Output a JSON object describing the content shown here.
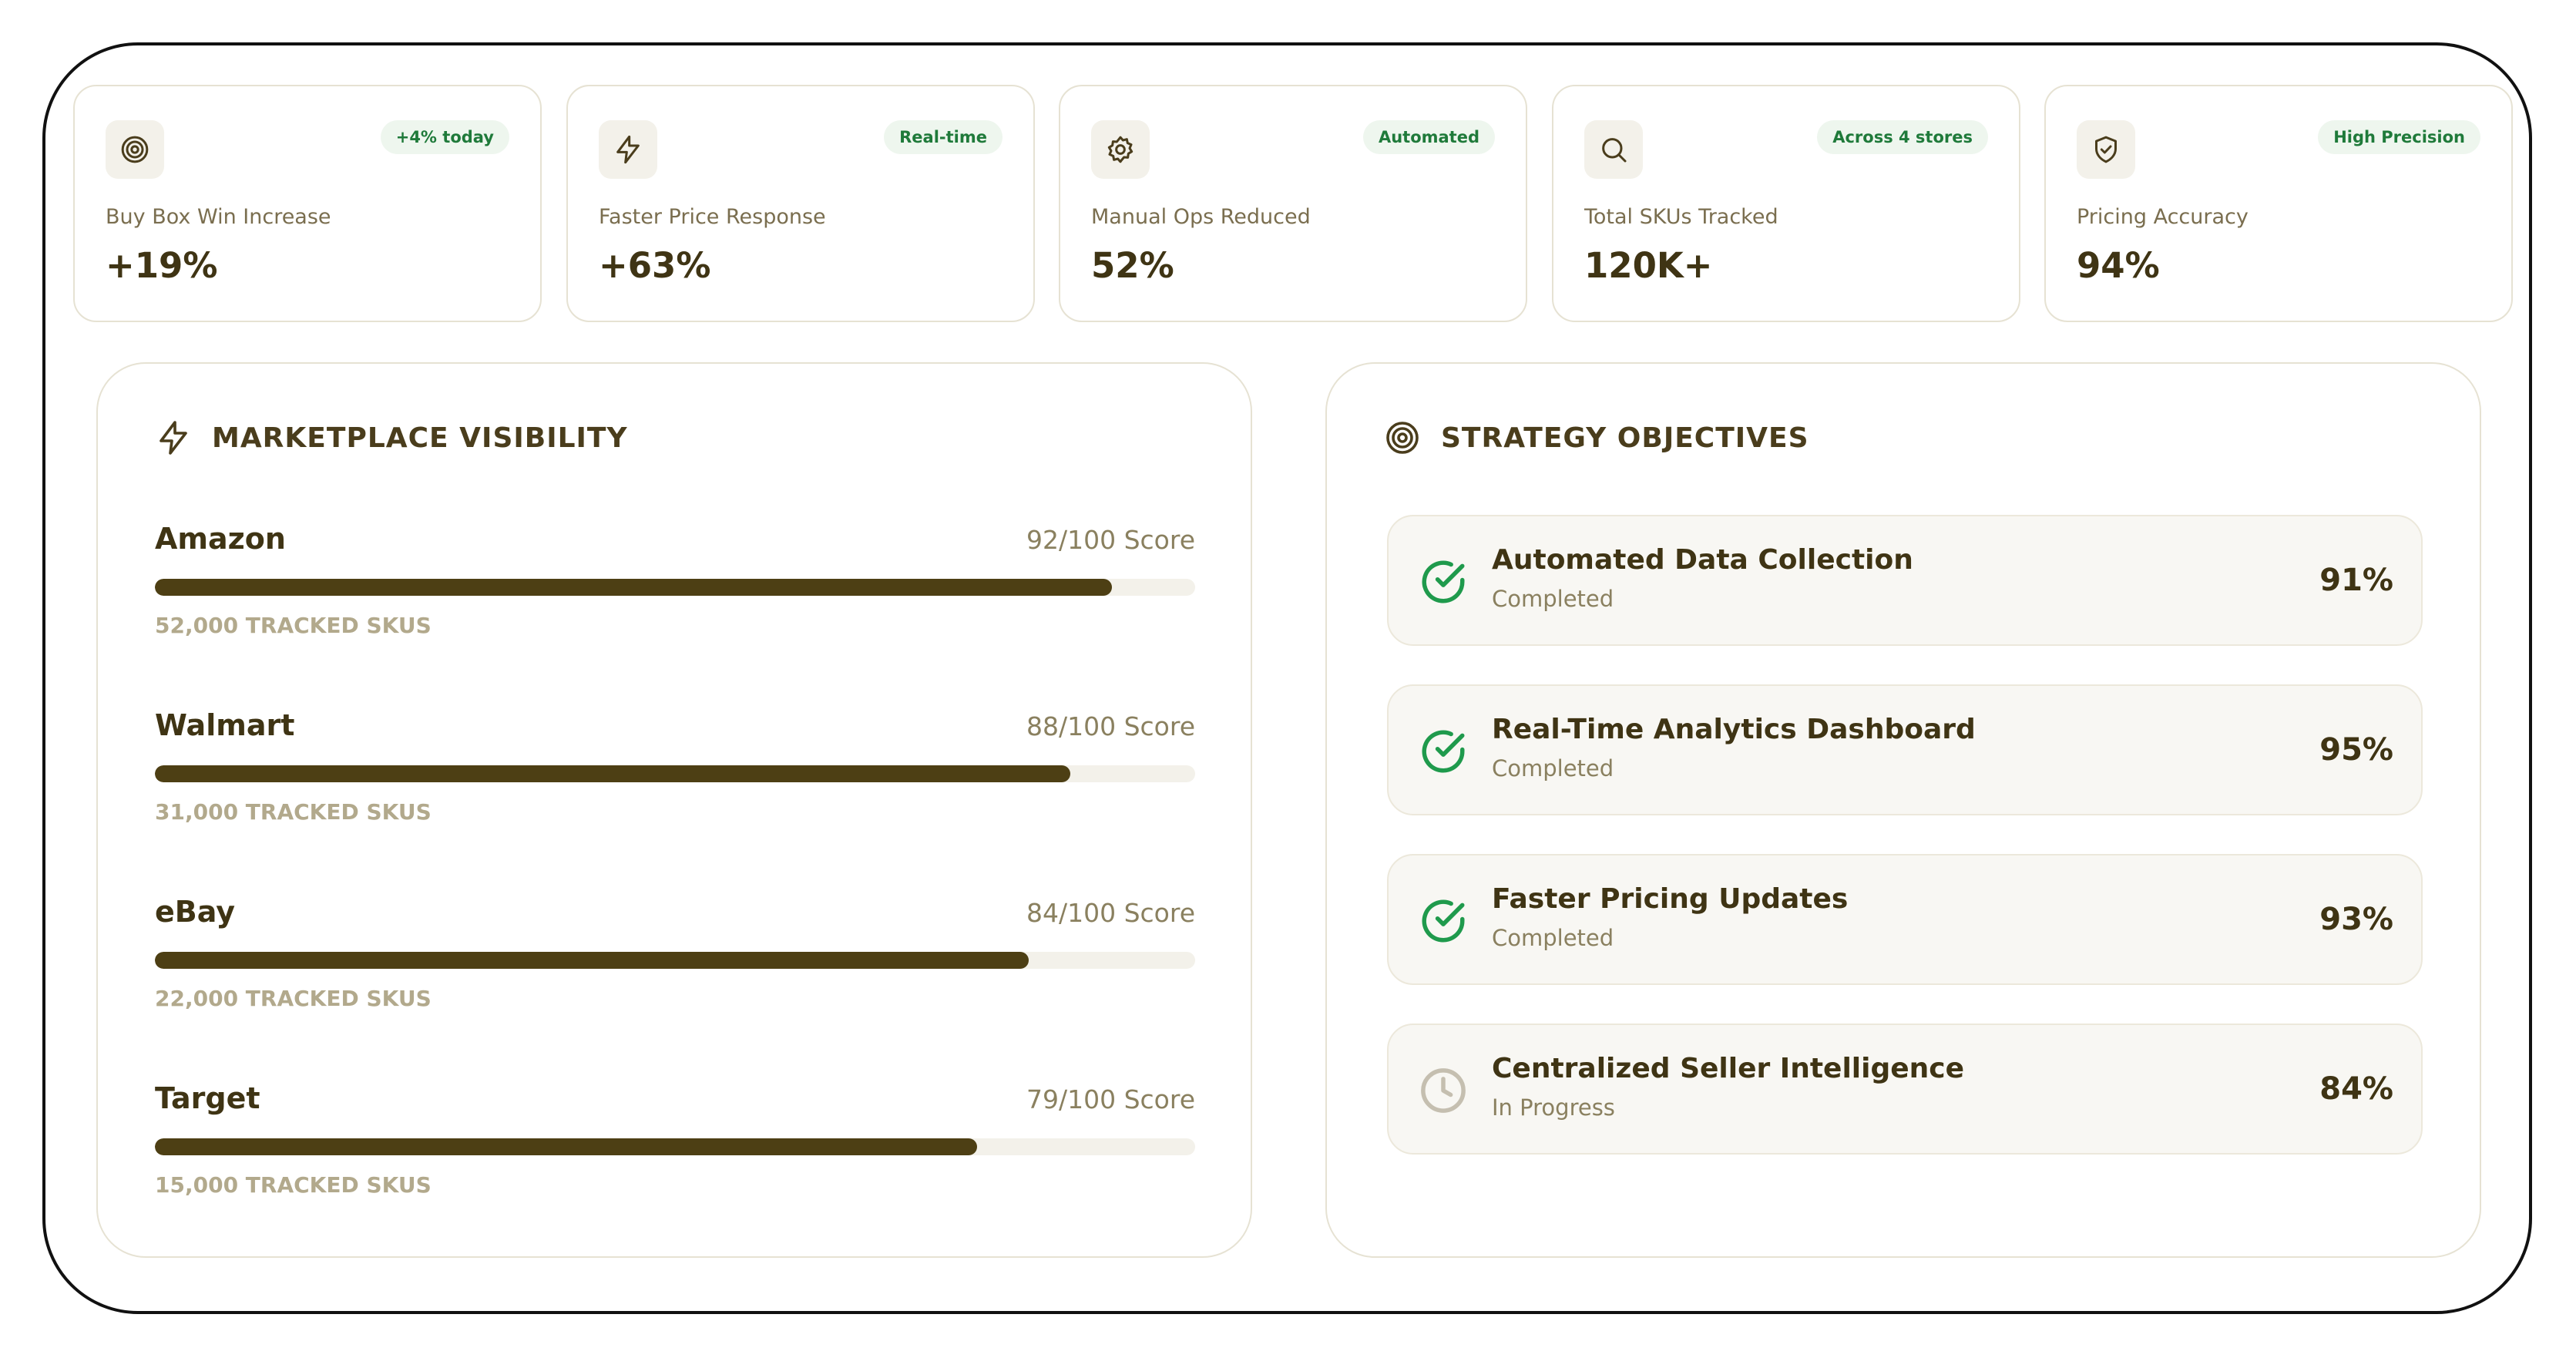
{
  "metrics": [
    {
      "icon": "target-icon",
      "badge": "+4% today",
      "label": "Buy Box Win Increase",
      "value": "+19%"
    },
    {
      "icon": "lightning-icon",
      "badge": "Real-time",
      "label": "Faster Price Response",
      "value": "+63%"
    },
    {
      "icon": "gear-icon",
      "badge": "Automated",
      "label": "Manual Ops Reduced",
      "value": "52%"
    },
    {
      "icon": "search-icon",
      "badge": "Across 4 stores",
      "label": "Total SKUs Tracked",
      "value": "120K+"
    },
    {
      "icon": "shield-check-icon",
      "badge": "High Precision",
      "label": "Pricing Accuracy",
      "value": "94%"
    }
  ],
  "visibility": {
    "title": "MARKETPLACE VISIBILITY",
    "icon": "lightning-icon",
    "items": [
      {
        "name": "Amazon",
        "score_text": "92/100 Score",
        "score": 92,
        "skus": "52,000 TRACKED SKUS"
      },
      {
        "name": "Walmart",
        "score_text": "88/100 Score",
        "score": 88,
        "skus": "31,000 TRACKED SKUS"
      },
      {
        "name": "eBay",
        "score_text": "84/100 Score",
        "score": 84,
        "skus": "22,000 TRACKED SKUS"
      },
      {
        "name": "Target",
        "score_text": "79/100 Score",
        "score": 79,
        "skus": "15,000 TRACKED SKUS"
      }
    ]
  },
  "objectives": {
    "title": "STRATEGY OBJECTIVES",
    "icon": "target-icon",
    "items": [
      {
        "title": "Automated Data Collection",
        "status": "Completed",
        "percent": "91%",
        "icon": "check-circle-icon"
      },
      {
        "title": "Real-Time Analytics Dashboard",
        "status": "Completed",
        "percent": "95%",
        "icon": "check-circle-icon"
      },
      {
        "title": "Faster Pricing Updates",
        "status": "Completed",
        "percent": "93%",
        "icon": "check-circle-icon"
      },
      {
        "title": "Centralized Seller Intelligence",
        "status": "In Progress",
        "percent": "84%",
        "icon": "clock-icon"
      }
    ]
  },
  "colors": {
    "text_dark": "#3f3414",
    "bar_fill": "#4d3f14",
    "bar_track": "#f3f1ea",
    "success_green": "#1f9a4c",
    "badge_green": "#1f7a3a",
    "pending_gray": "#c5bfb0"
  }
}
